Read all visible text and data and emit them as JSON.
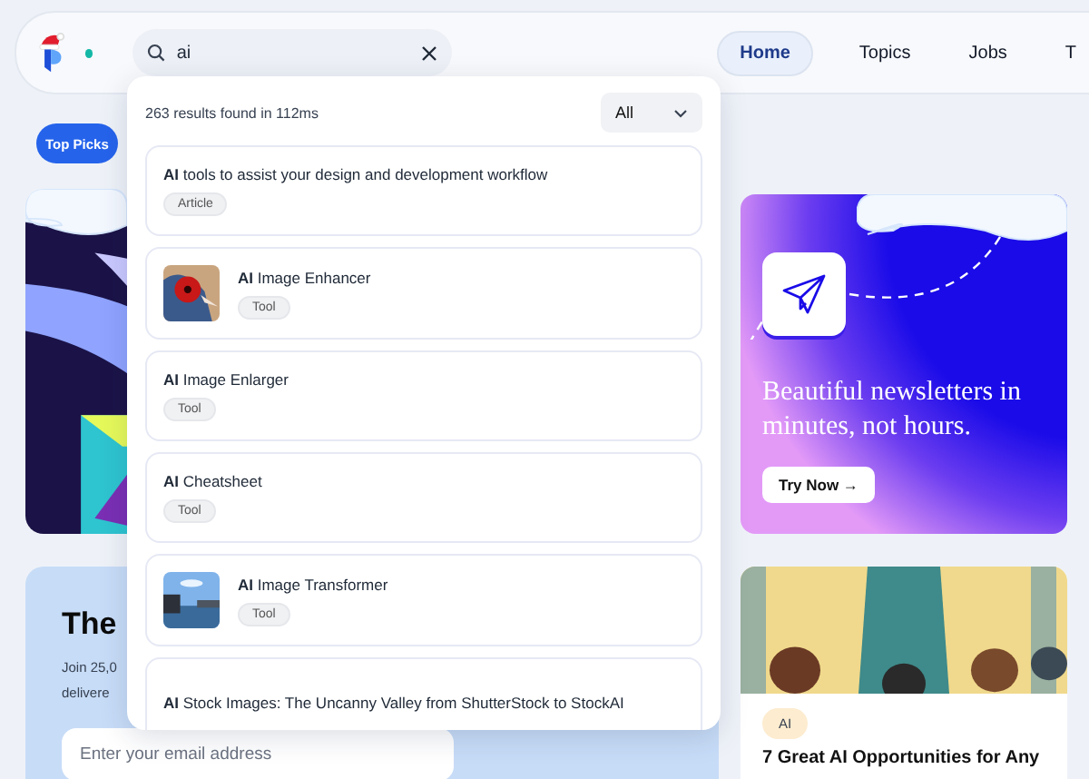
{
  "header": {
    "search": {
      "value": "ai"
    },
    "nav": [
      {
        "label": "Home",
        "selected": true
      },
      {
        "label": "Topics",
        "selected": false
      },
      {
        "label": "Jobs",
        "selected": false
      },
      {
        "label": "T",
        "selected": false
      }
    ]
  },
  "top_picks": "Top Picks",
  "search_results": {
    "summary": "263 results found in 112ms",
    "filter": "All",
    "items": [
      {
        "kind": "text",
        "title": "**AI** tools to assist your design and development workflow",
        "tag": "Article"
      },
      {
        "title": "**AI** Image Enhancer",
        "tag": "Tool"
      },
      {
        "kind": "text",
        "title": "**AI** Image Enlarger",
        "tag": "Tool"
      },
      {
        "kind": "text",
        "title": "**AI** Cheatsheet",
        "tag": "Tool"
      },
      {
        "title": "**AI** Image Transformer",
        "tag": "Tool"
      },
      {
        "kind": "text",
        "title": "**AI** Stock Images: The Uncanny Valley from ShutterStock to StockAI"
      }
    ]
  },
  "newsletter": {
    "heading": "The",
    "lines": [
      "Join 25,0",
      "delivere"
    ],
    "email_placeholder": "Enter your email address"
  },
  "promo": {
    "headline": "Beautiful newsletters in minutes, not hours.",
    "button": "Try Now →"
  },
  "article": {
    "tag": "AI",
    "title": "7 Great AI Opportunities for Any"
  }
}
